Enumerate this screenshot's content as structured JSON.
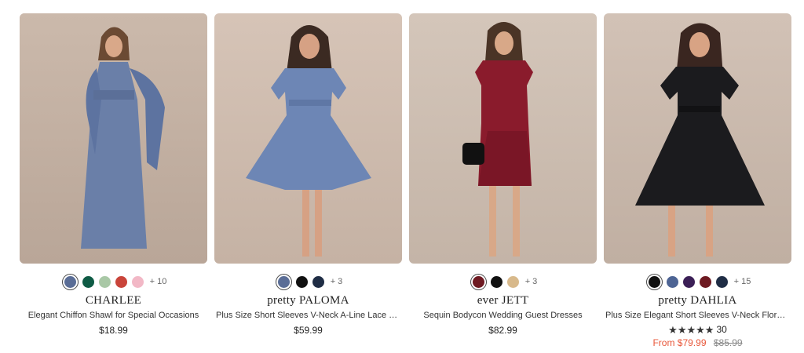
{
  "products": [
    {
      "brand": "CHARLEE",
      "title": "Elegant Chiffon Shawl for Special Occasions",
      "price": "$18.99",
      "swatches": [
        "#5a6d96",
        "#0f5b45",
        "#a9c8a6",
        "#c9443a",
        "#f2b8c6"
      ],
      "selected_swatch": 0,
      "more_colors": "+ 10",
      "image_alt": "Woman in blue chiffon maxi dress with shawl",
      "dress_color": "#6a7fa8",
      "bg_color": "#c7b5a8"
    },
    {
      "brand": "pretty PALOMA",
      "title": "Plus Size Short Sleeves V-Neck A-Line Lace Midi...",
      "price": "$59.99",
      "swatches": [
        "#5a6d96",
        "#111111",
        "#1f2d45"
      ],
      "selected_swatch": 0,
      "more_colors": "+ 3",
      "image_alt": "Woman in blue lace midi dress",
      "dress_color": "#6d86b5",
      "bg_color": "#d3c1b4"
    },
    {
      "brand": "ever JETT",
      "title": "Sequin Bodycon Wedding Guest Dresses",
      "price": "$82.99",
      "swatches": [
        "#6e1a22",
        "#111111",
        "#d8b98b"
      ],
      "selected_swatch": 0,
      "more_colors": "+ 3",
      "image_alt": "Woman in burgundy sequin bodycon dress",
      "dress_color": "#8a1b2c",
      "bg_color": "#cfc0b3"
    },
    {
      "brand": "pretty DAHLIA",
      "title": "Plus Size Elegant Short Sleeves V-Neck Floral...",
      "swatches": [
        "#111111",
        "#4d6494",
        "#3b1f56",
        "#6e1a22",
        "#1f2d45"
      ],
      "selected_swatch": 0,
      "more_colors": "+ 15",
      "rating_stars": "★★★★★",
      "rating_value": 5,
      "rating_count": "30",
      "sale_price": "From $79.99",
      "original_price": "$85.99",
      "image_alt": "Woman in black chiffon midi dress",
      "dress_color": "#1b1b1e",
      "bg_color": "#cdbcb0"
    }
  ],
  "colors": {
    "sale": "#e8573a",
    "text": "#222222"
  }
}
